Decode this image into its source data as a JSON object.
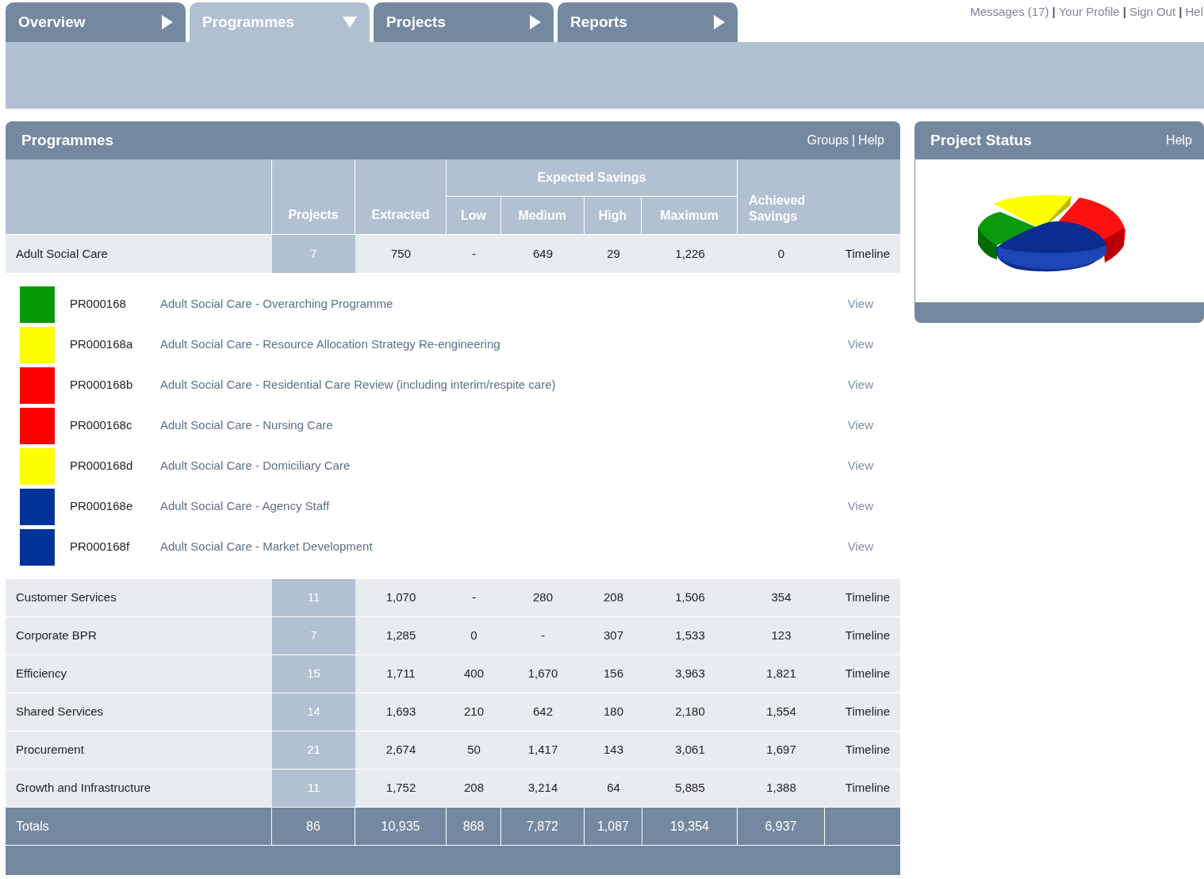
{
  "nav": {
    "tabs": [
      {
        "label": "Overview",
        "selected": false
      },
      {
        "label": "Programmes",
        "selected": true
      },
      {
        "label": "Projects",
        "selected": false
      },
      {
        "label": "Reports",
        "selected": false
      }
    ],
    "links": [
      "Messages (17)",
      "Your Profile",
      "Sign Out",
      "Hel"
    ],
    "separator": "|"
  },
  "programmes_panel": {
    "title": "Programmes",
    "links": [
      "Groups",
      "Help"
    ],
    "separator": "|",
    "columns": {
      "group": "Expected Savings",
      "projects": "Projects",
      "extracted": "Extracted",
      "low": "Low",
      "medium": "Medium",
      "high": "High",
      "maximum": "Maximum",
      "achieved": "Achieved Savings"
    },
    "rows": [
      {
        "name": "Adult Social Care",
        "projects": "7",
        "extracted": "750",
        "low": "-",
        "medium": "649",
        "high": "29",
        "maximum": "1,226",
        "achieved": "0",
        "link": "Timeline",
        "expanded": true,
        "children": [
          {
            "code": "PR000168",
            "title": "Adult Social Care - Overarching Programme",
            "color": "#069b06",
            "link": "View"
          },
          {
            "code": "PR000168a",
            "title": "Adult Social Care - Resource Allocation Strategy Re-engineering",
            "color": "#ffff00",
            "link": "View"
          },
          {
            "code": "PR000168b",
            "title": "Adult Social Care - Residential Care Review (including interim/respite care)",
            "color": "#ff0000",
            "link": "View"
          },
          {
            "code": "PR000168c",
            "title": "Adult Social Care - Nursing Care",
            "color": "#ff0000",
            "link": "View"
          },
          {
            "code": "PR000168d",
            "title": "Adult Social Care - Domiciliary Care",
            "color": "#ffff00",
            "link": "View"
          },
          {
            "code": "PR000168e",
            "title": "Adult Social Care - Agency Staff",
            "color": "#003399",
            "link": "View"
          },
          {
            "code": "PR000168f",
            "title": "Adult Social Care - Market Development",
            "color": "#003399",
            "link": "View"
          }
        ]
      },
      {
        "name": "Customer Services",
        "projects": "11",
        "extracted": "1,070",
        "low": "-",
        "medium": "280",
        "high": "208",
        "maximum": "1,506",
        "achieved": "354",
        "link": "Timeline",
        "expanded": false
      },
      {
        "name": "Corporate BPR",
        "projects": "7",
        "extracted": "1,285",
        "low": "0",
        "medium": "-",
        "high": "307",
        "maximum": "1,533",
        "achieved": "123",
        "link": "Timeline",
        "expanded": false
      },
      {
        "name": "Efficiency",
        "projects": "15",
        "extracted": "1,711",
        "low": "400",
        "medium": "1,670",
        "high": "156",
        "maximum": "3,963",
        "achieved": "1,821",
        "link": "Timeline",
        "expanded": false
      },
      {
        "name": "Shared Services",
        "projects": "14",
        "extracted": "1,693",
        "low": "210",
        "medium": "642",
        "high": "180",
        "maximum": "2,180",
        "achieved": "1,554",
        "link": "Timeline",
        "expanded": false
      },
      {
        "name": "Procurement",
        "projects": "21",
        "extracted": "2,674",
        "low": "50",
        "medium": "1,417",
        "high": "143",
        "maximum": "3,061",
        "achieved": "1,697",
        "link": "Timeline",
        "expanded": false
      },
      {
        "name": "Growth and Infrastructure",
        "projects": "11",
        "extracted": "1,752",
        "low": "208",
        "medium": "3,214",
        "high": "64",
        "maximum": "5,885",
        "achieved": "1,388",
        "link": "Timeline",
        "expanded": false
      }
    ],
    "totals": {
      "name": "Totals",
      "projects": "86",
      "extracted": "10,935",
      "low": "868",
      "medium": "7,872",
      "high": "1,087",
      "maximum": "19,354",
      "achieved": "6,937"
    }
  },
  "status_panel": {
    "title": "Project Status",
    "link": "Help"
  }
}
